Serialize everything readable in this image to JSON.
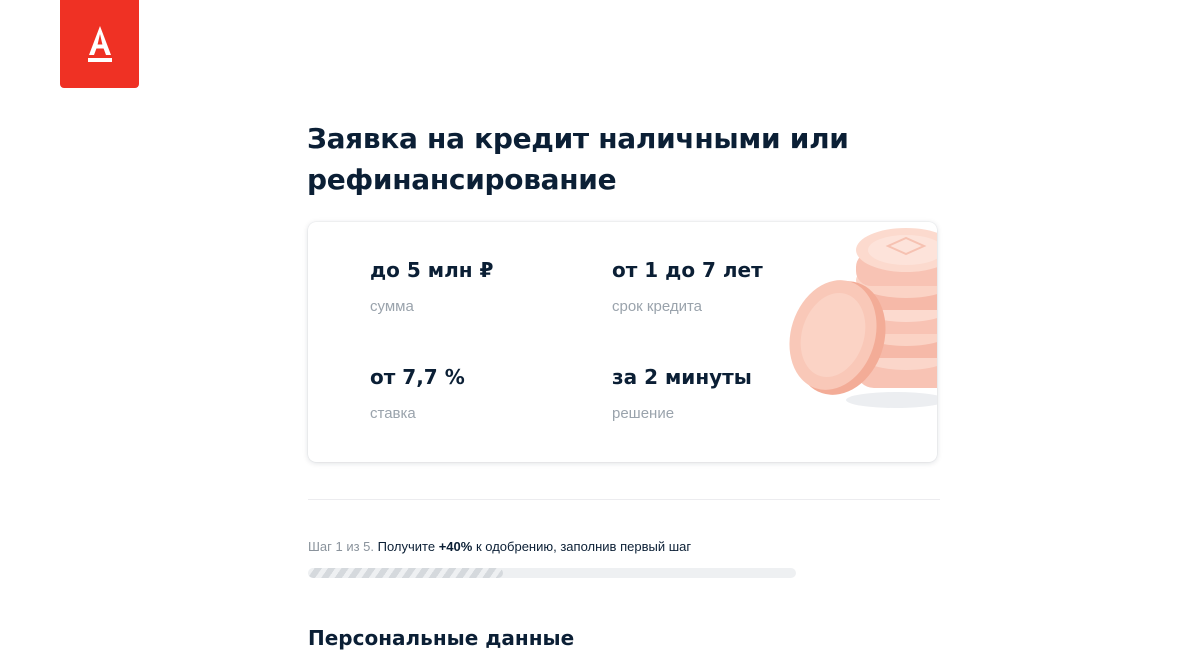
{
  "brand": {
    "logo_letter": "А",
    "color": "#ef3124"
  },
  "title": "Заявка на кредит наличными или рефинансирование",
  "features": [
    {
      "value": "до 5 млн ₽",
      "label": "сумма"
    },
    {
      "value": "от 1 до 7 лет",
      "label": "срок кредита"
    },
    {
      "value": "от 7,7 %",
      "label": "ставка"
    },
    {
      "value": "за 2 минуты",
      "label": "решение"
    }
  ],
  "decoration": {
    "icon": "coins-illustration-icon"
  },
  "step": {
    "prefix": "Шаг 1 из 5.",
    "text_before": "Получите",
    "highlight": "+40%",
    "text_after": "к одобрению, заполнив первый шаг",
    "progress_fraction": 0.4
  },
  "section_title": "Персональные данные"
}
